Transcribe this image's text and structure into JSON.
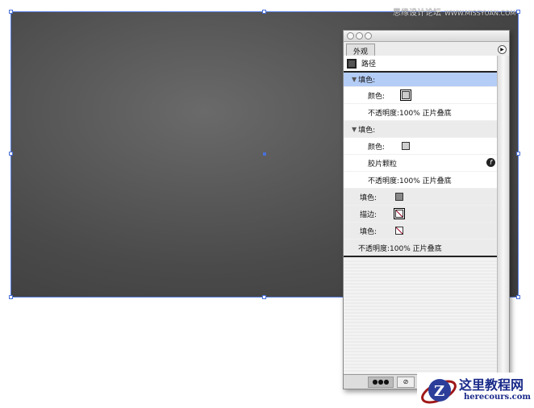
{
  "watermark": {
    "cn": "思缘设计论坛",
    "url": "WWW.MISSYUAN.COM"
  },
  "panel": {
    "tab": "外观",
    "object_label": "路径",
    "rows": [
      {
        "label": "填色:",
        "type": "header",
        "selected": true
      },
      {
        "label": "颜色:",
        "swatch": "#cccccc"
      },
      {
        "label": "不透明度:100% 正片叠底"
      },
      {
        "label": "填色:",
        "type": "header"
      },
      {
        "label": "颜色:",
        "swatch": "#d0d0d0"
      },
      {
        "label": "胶片颗粒",
        "icon": "fx-icon"
      },
      {
        "label": "不透明度:100% 正片叠底"
      },
      {
        "label": "填色:",
        "swatch": "#888888"
      },
      {
        "label": "描边:",
        "swatch": "none"
      },
      {
        "label": "填色:",
        "swatch": "none"
      },
      {
        "label": "不透明度:100% 正片叠底"
      }
    ]
  },
  "logo": {
    "cn": "这里教程网",
    "url": "herecours.com"
  }
}
